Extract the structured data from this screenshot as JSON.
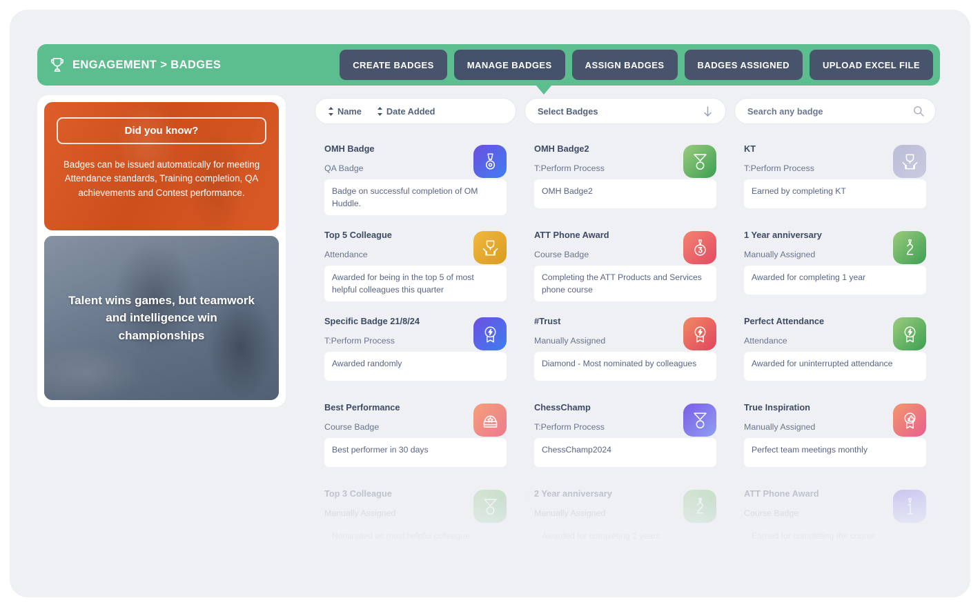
{
  "header": {
    "title": "ENGAGEMENT > BADGES",
    "icon": "trophy-icon",
    "bg_color": "#5cbd8e",
    "buttons": [
      {
        "label": "CREATE BADGES",
        "active": false
      },
      {
        "label": "MANAGE BADGES",
        "active": true
      },
      {
        "label": "ASSIGN BADGES",
        "active": false
      },
      {
        "label": "BADGES ASSIGNED",
        "active": false
      },
      {
        "label": "UPLOAD EXCEL FILE",
        "active": false
      }
    ],
    "button_color": "#47546b"
  },
  "sidebar": {
    "promo": {
      "badge_label": "Did you know?",
      "text": "Badges can be issued automatically for meeting Attendance standards, Training completion, QA achievements and Contest performance.",
      "bg_color": "#d9541e"
    },
    "quote": {
      "text": "Talent wins games, but teamwork and intelligence win championships",
      "bg_color": "#7d8b9e"
    }
  },
  "filters": {
    "sort": {
      "name_label": "Name",
      "date_label": "Date Added",
      "icon": "sort-arrows-icon"
    },
    "select": {
      "label": "Select Badges",
      "icon": "arrow-down-icon"
    },
    "search": {
      "value": "",
      "placeholder": "Search any badge",
      "icon": "search-icon"
    }
  },
  "badges": [
    {
      "name": "OMH Badge",
      "type": "QA Badge",
      "description": "Badge on successful completion of OM Huddle.",
      "icon": "medal-icon",
      "gradient_from": "#6c4fe0",
      "gradient_to": "#3f7ef0",
      "faded": false
    },
    {
      "name": "OMH Badge2",
      "type": "T:Perform Process",
      "description": "OMH Badge2",
      "icon": "medal-ribbon-icon",
      "gradient_from": "#9ccb7e",
      "gradient_to": "#3c9f52",
      "faded": false
    },
    {
      "name": "KT",
      "type": "T:Perform Process",
      "description": "Earned by completing KT",
      "icon": "trophy-hands-icon",
      "gradient_from": "#b9bdd6",
      "gradient_to": "#c9cbdf",
      "faded": false
    },
    {
      "name": "Top 5 Colleague",
      "type": "Attendance",
      "description": "Awarded for being in the top 5 of most helpful colleagues this quarter",
      "icon": "trophy-hands-icon",
      "gradient_from": "#f0b940",
      "gradient_to": "#d99b1e",
      "faded": false
    },
    {
      "name": "ATT Phone Award",
      "type": "Course Badge",
      "description": "Completing the ATT Products and Services phone course",
      "icon": "medal-three-icon",
      "gradient_from": "#f4836f",
      "gradient_to": "#e24b63",
      "faded": false
    },
    {
      "name": "1 Year anniversary",
      "type": "Manually Assigned",
      "description": "Awarded for completing 1 year",
      "icon": "number-two-icon",
      "gradient_from": "#9ccb7e",
      "gradient_to": "#3c9f52",
      "faded": false
    },
    {
      "name": "Specific Badge 21/8/24",
      "type": "T:Perform Process",
      "description": "Awarded randomly",
      "icon": "award-bolt-icon",
      "gradient_from": "#6c4fe0",
      "gradient_to": "#3f7ef0",
      "faded": false
    },
    {
      "name": "#Trust",
      "type": "Manually Assigned",
      "description": "Diamond - Most nominated by colleagues",
      "icon": "award-bolt-icon",
      "gradient_from": "#f08a62",
      "gradient_to": "#e2445f",
      "faded": false
    },
    {
      "name": "Perfect Attendance",
      "type": "Attendance",
      "description": "Awarded for uninterrupted attendance",
      "icon": "award-bolt-icon",
      "gradient_from": "#9ccb7e",
      "gradient_to": "#3c9f52",
      "faded": false
    },
    {
      "name": "Best Performance",
      "type": "Course Badge",
      "description": "Best performer in 30 days",
      "icon": "award-star-icon",
      "gradient_from": "#f5a07a",
      "gradient_to": "#ec7a8e",
      "faded": false
    },
    {
      "name": "ChessChamp",
      "type": "T:Perform Process",
      "description": "ChessChamp2024",
      "icon": "medal-ribbon-icon",
      "gradient_from": "#7b5ce8",
      "gradient_to": "#8f9ff0",
      "faded": false
    },
    {
      "name": "True Inspiration",
      "type": "Manually Assigned",
      "description": "Perfect team meetings monthly",
      "icon": "award-thumb-icon",
      "gradient_from": "#f2976c",
      "gradient_to": "#e85f8e",
      "faded": false
    },
    {
      "name": "Top 3 Colleague",
      "type": "Manually Assigned",
      "description": "Nominated as most helpful colleague",
      "icon": "medal-ribbon-icon",
      "gradient_from": "#9ccb7e",
      "gradient_to": "#3c9f52",
      "faded": true
    },
    {
      "name": "2 Year anniversary",
      "type": "Manually Assigned",
      "description": "Awarded for completing 2 years",
      "icon": "number-two-icon",
      "gradient_from": "#9ccb7e",
      "gradient_to": "#3c9f52",
      "faded": true
    },
    {
      "name": "ATT Phone Award",
      "type": "Course Badge",
      "description": "Earned for completing the course",
      "icon": "number-one-icon",
      "gradient_from": "#7b5ce8",
      "gradient_to": "#8f9ff0",
      "faded": true
    }
  ]
}
